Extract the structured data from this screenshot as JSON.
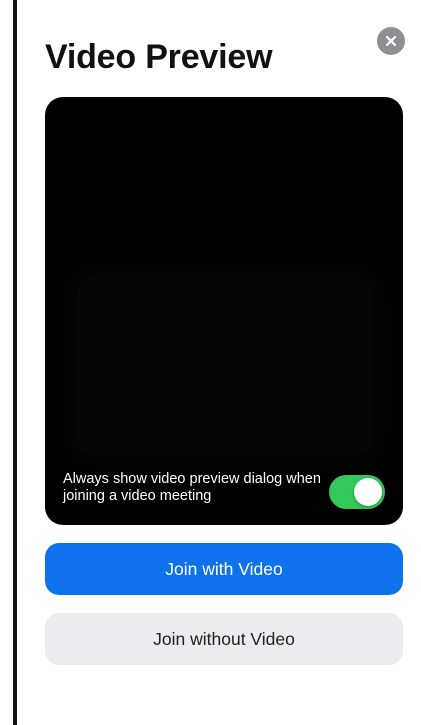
{
  "dialog": {
    "title": "Video Preview",
    "close_icon": "close-icon",
    "preview": {
      "always_show_label": "Always show video preview dialog when joining a video meeting",
      "always_show_enabled": true
    },
    "join_with_video_label": "Join with Video",
    "join_without_video_label": "Join without Video"
  },
  "colors": {
    "primary": "#0e72ed",
    "toggle_on": "#34c759",
    "secondary_button": "#ececf0",
    "preview_background": "#010101",
    "close_button": "#8e8e93"
  }
}
